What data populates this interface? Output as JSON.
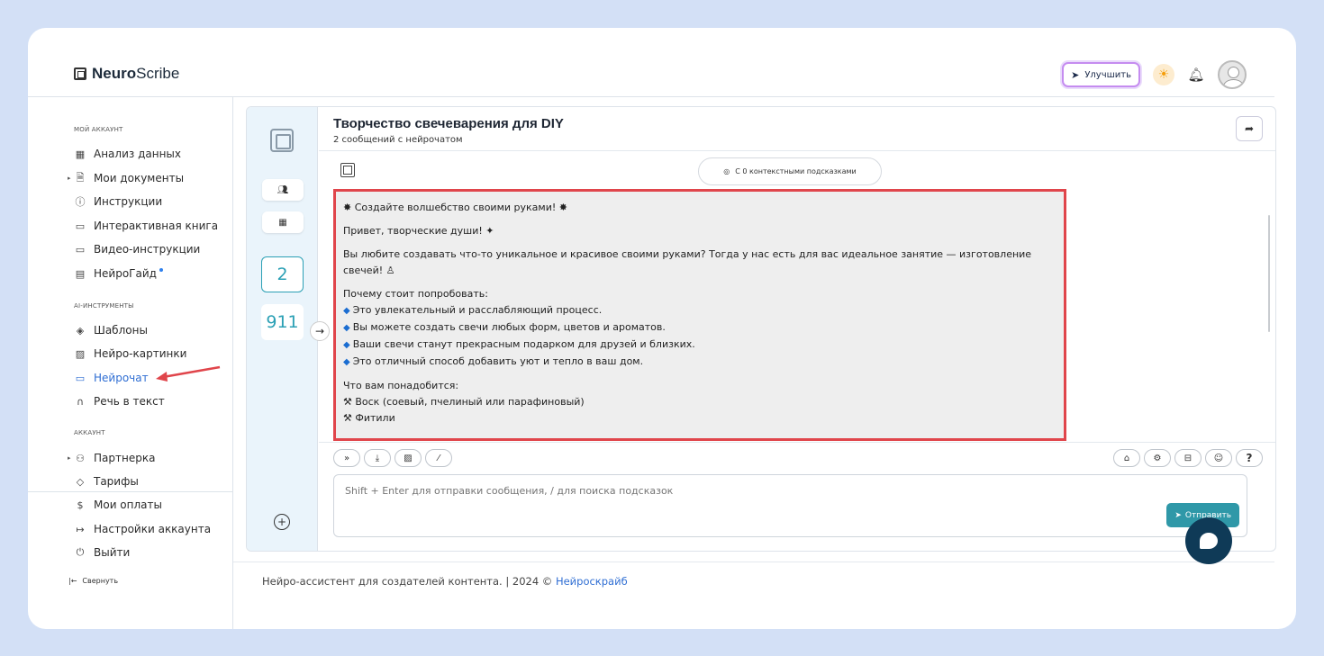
{
  "brand": {
    "name_bold": "Neuro",
    "name_rest": "Scribe"
  },
  "header": {
    "upgrade_label": "Улучшить"
  },
  "sidebar": {
    "section_account": "МОЙ АККАУНТ",
    "account_items": [
      {
        "label": "Анализ данных",
        "icon": "grid-icon"
      },
      {
        "label": "Мои документы",
        "icon": "document-icon"
      },
      {
        "label": "Инструкции",
        "icon": "help-icon"
      },
      {
        "label": "Интерактивная книга",
        "icon": "book-icon"
      },
      {
        "label": "Видео-инструкции",
        "icon": "video-icon"
      },
      {
        "label": "НейроГайд",
        "icon": "guide-icon"
      }
    ],
    "section_ai": "AI-ИНСТРУМЕНТЫ",
    "ai_items": [
      {
        "label": "Шаблоны",
        "icon": "layers-icon"
      },
      {
        "label": "Нейро-картинки",
        "icon": "image-icon"
      },
      {
        "label": "Нейрочат",
        "icon": "chat-icon"
      },
      {
        "label": "Речь в текст",
        "icon": "headphones-icon"
      }
    ],
    "section_acc2": "АККАУНТ",
    "acc2_items": [
      {
        "label": "Партнерка",
        "icon": "users-icon"
      },
      {
        "label": "Тарифы",
        "icon": "tag-icon"
      },
      {
        "label": "Мои оплаты",
        "icon": "dollar-icon"
      },
      {
        "label": "Настройки аккаунта",
        "icon": "login-icon"
      },
      {
        "label": "Выйти",
        "icon": "power-icon"
      }
    ],
    "collapse_label": "Свернуть"
  },
  "chat": {
    "title": "Творчество свечеварения для DIY",
    "subtitle": "2 сообщений с нейрочатом",
    "hints_label": "С 0 контекстными подсказками",
    "count_a": "2",
    "count_b": "911",
    "message": {
      "headline": "Создайте волшебство своими руками!",
      "greeting": "Привет, творческие души!",
      "intro": "Вы любите создавать что-то уникальное и красивое своими руками? Тогда у нас есть для вас идеальное занятие — изготовление свечей!",
      "why_title": "Почему стоит попробовать:",
      "why_items": [
        "Это увлекательный и расслабляющий процесс.",
        "Вы можете создать свечи любых форм, цветов и ароматов.",
        "Ваши свечи станут прекрасным подарком для друзей и близких.",
        "Это отличный способ добавить уют и тепло в ваш дом."
      ],
      "need_title": "Что вам понадобится:",
      "need_items": [
        "Воск (соевый, пчелиный или парафиновый)",
        "Фитили"
      ]
    },
    "input_placeholder": "Shift + Enter для отправки сообщения, / для поиска подсказок",
    "send_label": "Отправить"
  },
  "footer": {
    "text": "Нейро-ассистент для создателей контента.  | 2024 © ",
    "link": "Нейроскрайб"
  },
  "colors": {
    "accent": "#2f98a8",
    "highlight": "#e0454b",
    "link": "#2f6ed3"
  }
}
